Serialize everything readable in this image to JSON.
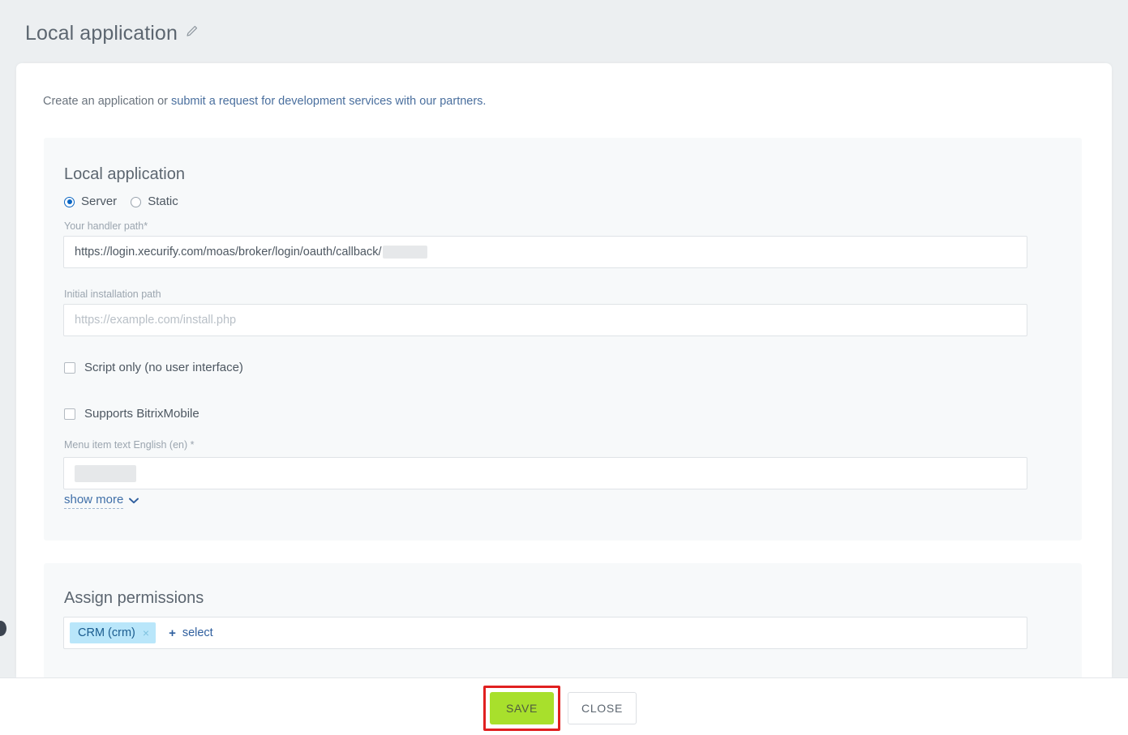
{
  "header": {
    "title": "Local application",
    "edit_icon": "pencil-icon"
  },
  "card": {
    "intro_prefix": "Create an application or ",
    "intro_link": "submit a request for development services with our partners."
  },
  "app_panel": {
    "title": "Local application",
    "type_options": [
      {
        "label": "Server",
        "selected": true
      },
      {
        "label": "Static",
        "selected": false
      }
    ],
    "handler_path": {
      "label": "Your handler path*",
      "value": "https://login.xecurify.com/moas/broker/login/oauth/callback/",
      "value_redacted": true
    },
    "install_path": {
      "label": "Initial installation path",
      "value": "",
      "placeholder": "https://example.com/install.php"
    },
    "script_only": {
      "label": "Script only (no user interface)",
      "checked": false
    },
    "bitrix_mobile": {
      "label": "Supports BitrixMobile",
      "checked": false
    },
    "menu_item_text": {
      "label": "Menu item text English (en) *",
      "value": "",
      "value_redacted": true
    },
    "show_more": {
      "label": "show more",
      "chevron_icon": "chevron-down-icon"
    }
  },
  "permissions_panel": {
    "title": "Assign permissions",
    "chips": [
      {
        "label": "CRM (crm)",
        "remove_icon": "close-icon"
      }
    ],
    "select_label": "select",
    "plus_icon": "plus-icon"
  },
  "footer": {
    "save_label": "SAVE",
    "close_label": "CLOSE"
  },
  "colors": {
    "page_background": "#eceff1",
    "card_background": "#ffffff",
    "panel_background": "#f7f9fa",
    "radio_accent": "#0b66c3",
    "link": "#4a6f9e",
    "chip_background": "#b9e6fa",
    "chip_text": "#1a5c8f",
    "save_button": "#a8e02c",
    "annotation_highlight": "#e02020"
  }
}
